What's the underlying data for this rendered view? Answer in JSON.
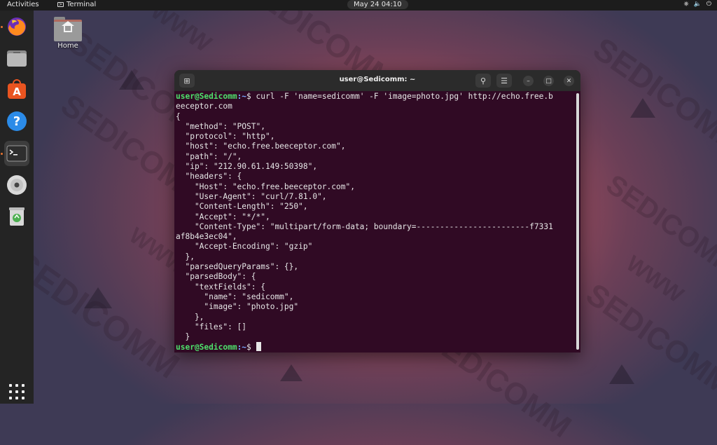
{
  "topbar": {
    "activities": "Activities",
    "app_name": "Terminal",
    "clock": "May 24  04:10",
    "tray": {
      "network": "network-icon",
      "volume": "volume-icon",
      "power": "power-icon"
    }
  },
  "desktop": {
    "home_label": "Home"
  },
  "dock": {
    "items": [
      "firefox-icon",
      "files-icon",
      "software-icon",
      "help-icon",
      "terminal-icon",
      "disc-icon",
      "trash-icon"
    ],
    "apps_grid": "apps-grid-icon"
  },
  "watermark": {
    "brand": "SEDICOMM",
    "www": "WWW"
  },
  "terminal": {
    "title": "user@Sedicomm: ~",
    "prompt_user": "user@Sedicomm",
    "prompt_path": ":~",
    "prompt_sym": "$ ",
    "command": "curl -F 'name=sedicomm' -F 'image=photo.jpg' http://echo.free.b",
    "command_wrap": "eeceptor.com",
    "output": [
      "{",
      "  \"method\": \"POST\",",
      "  \"protocol\": \"http\",",
      "  \"host\": \"echo.free.beeceptor.com\",",
      "  \"path\": \"/\",",
      "  \"ip\": \"212.90.61.149:50398\",",
      "  \"headers\": {",
      "    \"Host\": \"echo.free.beeceptor.com\",",
      "    \"User-Agent\": \"curl/7.81.0\",",
      "    \"Content-Length\": \"250\",",
      "    \"Accept\": \"*/*\",",
      "    \"Content-Type\": \"multipart/form-data; boundary=------------------------f7331",
      "af8b4e3ec04\",",
      "    \"Accept-Encoding\": \"gzip\"",
      "  },",
      "  \"parsedQueryParams\": {},",
      "  \"parsedBody\": {",
      "    \"textFields\": {",
      "      \"name\": \"sedicomm\",",
      "      \"image\": \"photo.jpg\"",
      "    },",
      "    \"files\": []",
      "  }"
    ]
  }
}
